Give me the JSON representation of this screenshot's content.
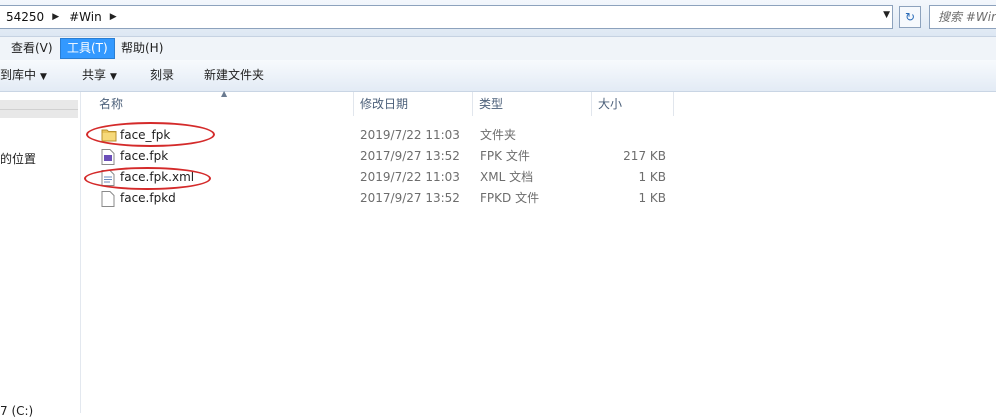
{
  "address": {
    "crumbs": [
      "54250",
      "#Win"
    ],
    "separator": "▶",
    "dropdown": "▼",
    "refresh": "↻",
    "search_placeholder": "搜索 #Win"
  },
  "menu": {
    "items": [
      "查看(V)",
      "工具(T)",
      "帮助(H)"
    ],
    "active": "工具(T)"
  },
  "toolbar": {
    "library": "到库中",
    "share": "共享",
    "burn": "刻录",
    "new_folder": "新建文件夹",
    "arrow": "▼"
  },
  "nav": {
    "location_fragment": "的位置",
    "drive_fragment": "7 (C:)"
  },
  "columns": {
    "name": "名称",
    "date": "修改日期",
    "type": "类型",
    "size": "大小"
  },
  "files": [
    {
      "name": "face_fpk",
      "date": "2019/7/22 11:03",
      "type": "文件夹",
      "size": "",
      "icon": "folder-icon"
    },
    {
      "name": "face.fpk",
      "date": "2017/9/27 13:52",
      "type": "FPK 文件",
      "size": "217 KB",
      "icon": "fpk-file-icon"
    },
    {
      "name": "face.fpk.xml",
      "date": "2019/7/22 11:03",
      "type": "XML 文档",
      "size": "1 KB",
      "icon": "xml-file-icon"
    },
    {
      "name": "face.fpkd",
      "date": "2017/9/27 13:52",
      "type": "FPKD 文件",
      "size": "1 KB",
      "icon": "blank-file-icon"
    }
  ],
  "annotation_color": "#d42a2a"
}
